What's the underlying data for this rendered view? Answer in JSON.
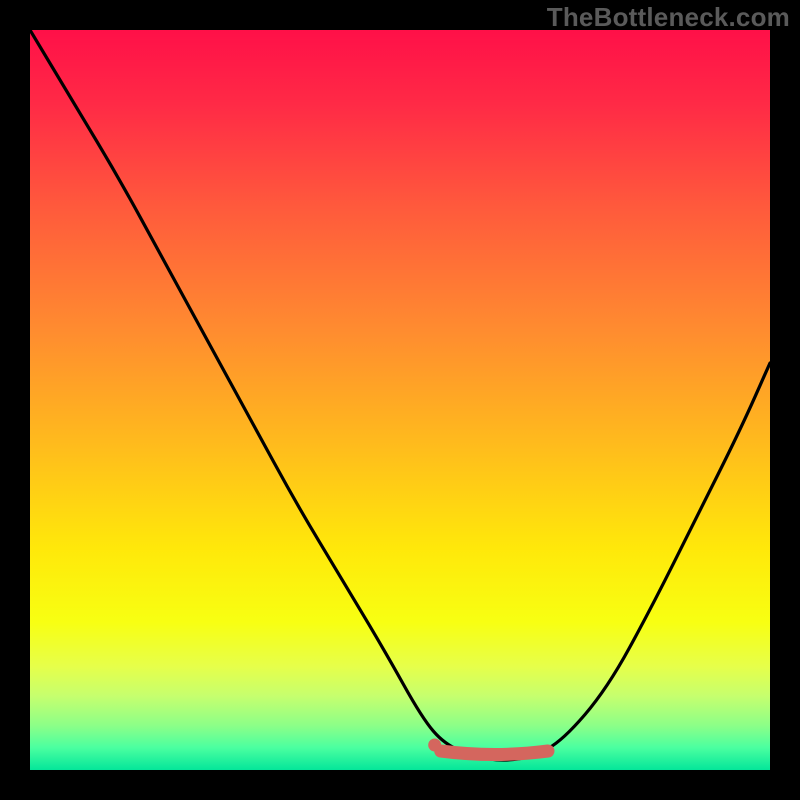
{
  "watermark": "TheBottleneck.com",
  "chart_data": {
    "type": "line",
    "title": "",
    "xlabel": "",
    "ylabel": "",
    "xlim": [
      0,
      1
    ],
    "ylim": [
      0,
      1
    ],
    "series": [
      {
        "name": "curve",
        "x": [
          0.0,
          0.06,
          0.12,
          0.18,
          0.24,
          0.3,
          0.36,
          0.42,
          0.48,
          0.53,
          0.56,
          0.6,
          0.64,
          0.68,
          0.72,
          0.78,
          0.84,
          0.9,
          0.96,
          1.0
        ],
        "y": [
          1.0,
          0.9,
          0.8,
          0.69,
          0.58,
          0.47,
          0.36,
          0.26,
          0.16,
          0.07,
          0.035,
          0.018,
          0.012,
          0.018,
          0.04,
          0.11,
          0.22,
          0.34,
          0.46,
          0.55
        ]
      },
      {
        "name": "highlight-band",
        "x": [
          0.555,
          0.7
        ],
        "y": [
          0.023,
          0.023
        ]
      }
    ],
    "colors": {
      "curve": "#000000",
      "highlight": "#d4665e",
      "gradient_top": "#ff1048",
      "gradient_bottom": "#04e69a"
    }
  }
}
